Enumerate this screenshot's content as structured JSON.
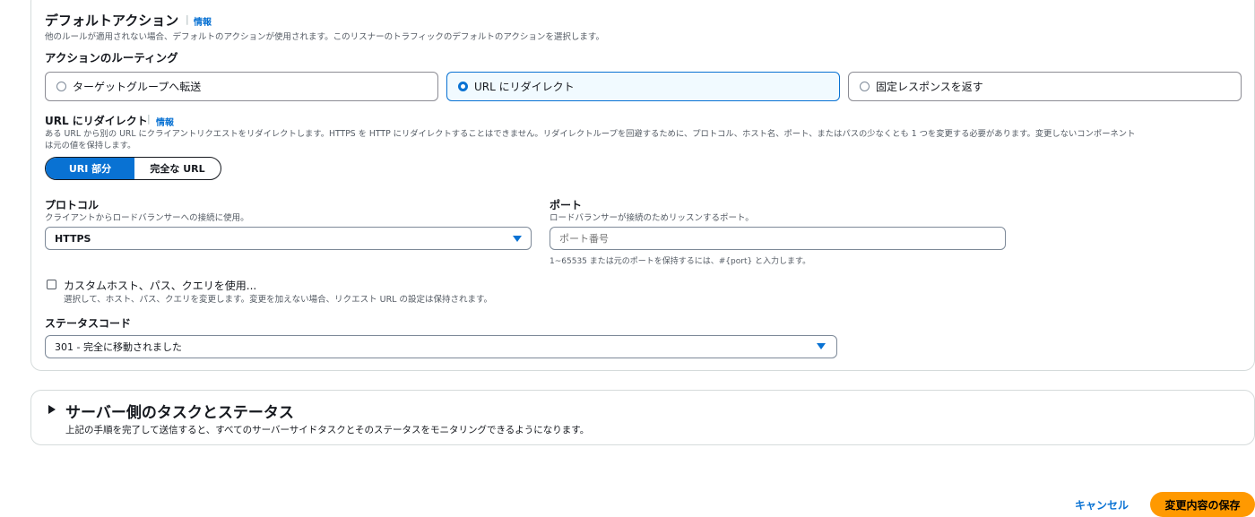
{
  "default_action": {
    "title": "デフォルトアクション",
    "info": "情報",
    "description": "他のルールが適用されない場合、デフォルトのアクションが使用されます。このリスナーのトラフィックのデフォルトのアクションを選択します。"
  },
  "routing": {
    "label": "アクションのルーティング",
    "options": [
      {
        "label": "ターゲットグループへ転送",
        "selected": false
      },
      {
        "label": "URL にリダイレクト",
        "selected": true
      },
      {
        "label": "固定レスポンスを返す",
        "selected": false
      }
    ]
  },
  "redirect": {
    "title": "URL にリダイレクト",
    "info": "情報",
    "description_line1": "ある URL から別の URL にクライアントリクエストをリダイレクトします。HTTPS を HTTP にリダイレクトすることはできません。リダイレクトループを回避するために、プロトコル、ホスト名、ポート、またはパスの少なくとも 1 つを変更する必要があります。変更しないコンポーネント",
    "description_line2": "は元の値を保持します。",
    "segments": {
      "uri": "URI 部分",
      "full": "完全な URL"
    }
  },
  "protocol": {
    "label": "プロトコル",
    "description": "クライアントからロードバランサーへの接続に使用。",
    "value": "HTTPS"
  },
  "port": {
    "label": "ポート",
    "description": "ロードバランサーが接続のためリッスンするポート。",
    "placeholder": "ポート番号",
    "hint": "1~65535 または元のポートを保持するには、#{port} と入力します。"
  },
  "custom": {
    "label": "カスタムホスト、パス、クエリを使用...",
    "description": "選択して、ホスト、パス、クエリを変更します。変更を加えない場合、リクエスト URL の設定は保持されます。"
  },
  "status_code": {
    "label": "ステータスコード",
    "value": "301 - 完全に移動されました"
  },
  "server_tasks": {
    "title": "サーバー側のタスクとステータス",
    "description": "上記の手順を完了して送信すると、すべてのサーバーサイドタスクとそのステータスをモニタリングできるようになります。"
  },
  "footer": {
    "cancel": "キャンセル",
    "save": "変更内容の保存"
  }
}
